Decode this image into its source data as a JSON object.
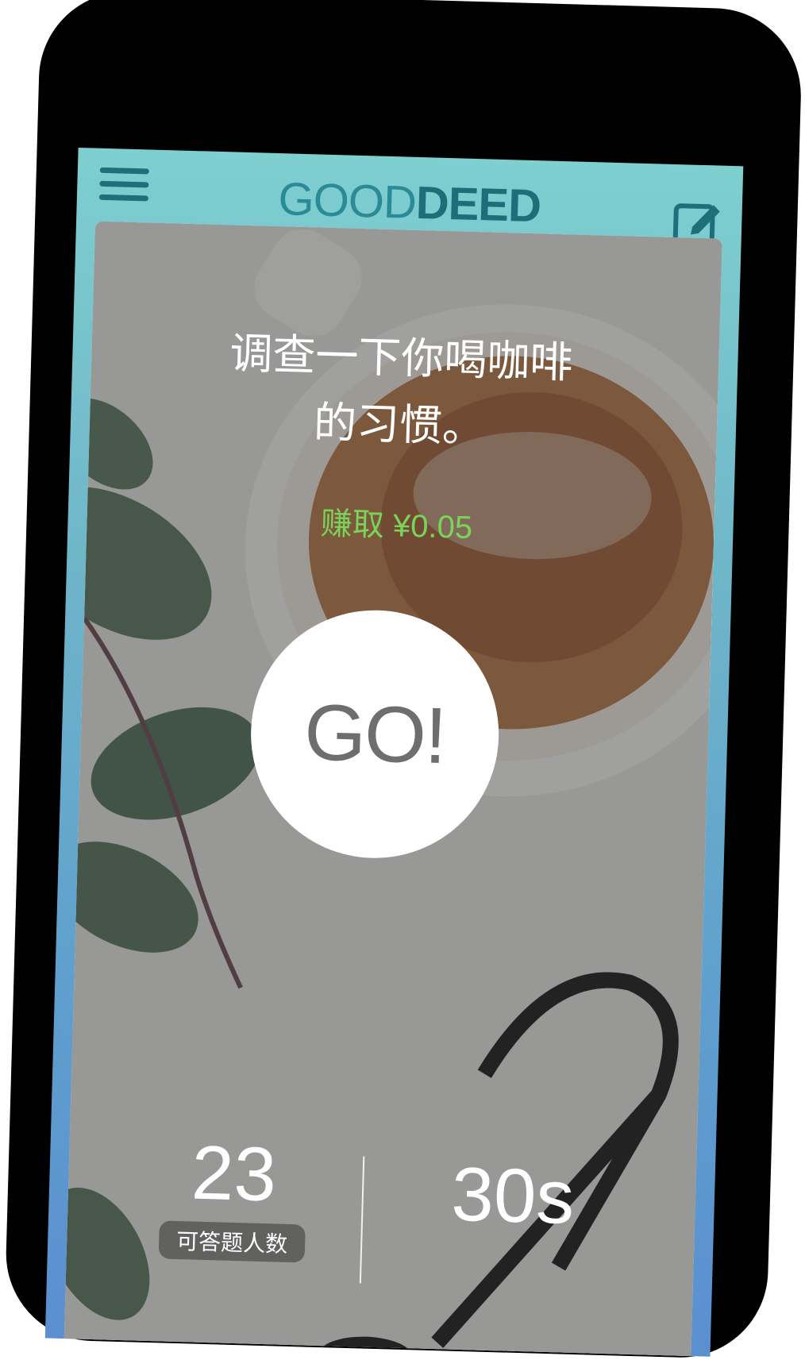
{
  "app": {
    "logo_light": "GOOD",
    "logo_bold": "DEED"
  },
  "icons": {
    "menu": "hamburger-menu-icon",
    "edit": "edit-note-icon"
  },
  "colors": {
    "header_teal": "#7ecfd0",
    "logo": "#1f6d78",
    "reward_green": "#7cd35a",
    "go_text": "#6e6e6e"
  },
  "task": {
    "question_line1": "调查一下你喝咖啡",
    "question_line2": "的习惯。",
    "reward": "赚取 ¥0.05",
    "go_label": "GO!"
  },
  "stats": {
    "remaining_value": "23",
    "remaining_label": "可答题人数",
    "duration_value": "30s"
  }
}
